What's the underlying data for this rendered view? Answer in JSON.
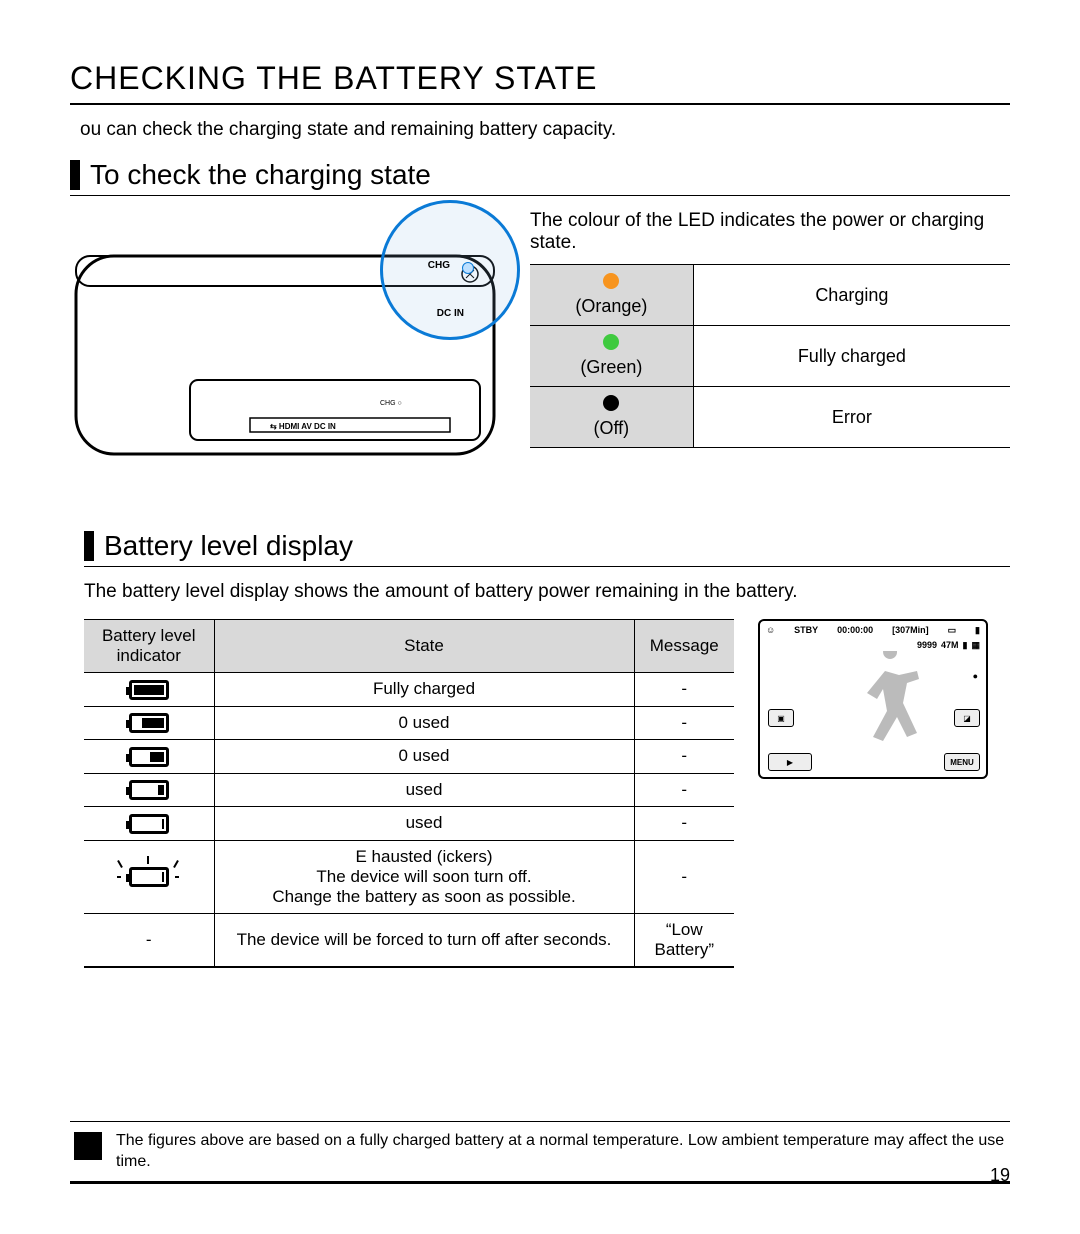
{
  "title": "CHECKING THE BATTERY STATE",
  "intro": "ou can check the charging state and remaining battery capacity.",
  "section1": {
    "heading": "To check the charging state",
    "legend_intro": "The colour of the LED indicates the power or charging state.",
    "cam_labels": {
      "chg": "CHG",
      "dcin": "DC IN"
    },
    "rows": [
      {
        "color_name": "(Orange)",
        "meaning": "Charging"
      },
      {
        "color_name": "(Green)",
        "meaning": "Fully charged"
      },
      {
        "color_name": "(Off)",
        "meaning": "Error"
      }
    ]
  },
  "section2": {
    "heading": "Battery level display",
    "intro": "The battery level display shows the amount of battery power remaining in the battery.",
    "headers": {
      "c1": "Battery level indicator",
      "c2": "State",
      "c3": "Message"
    },
    "rows": [
      {
        "state": "Fully charged",
        "msg": "-"
      },
      {
        "state": "0   used",
        "msg": "-"
      },
      {
        "state": "0     used",
        "msg": "-"
      },
      {
        "state": "used",
        "msg": "-"
      },
      {
        "state": "used",
        "msg": "-"
      },
      {
        "state": "E hausted (ickers)\nThe device will soon turn off.\nChange the battery as soon as possible.",
        "msg": "-"
      },
      {
        "state": "The device will be forced to turn off after   seconds.",
        "msg": "“Low Battery”"
      }
    ],
    "preview": {
      "stby": "STBY",
      "time": "00:00:00",
      "rem": "[307Min]",
      "shots": "9999",
      "mp": "47M",
      "menu": "MENU"
    }
  },
  "footnote": "The figures above are based on a fully charged battery at a normal temperature. Low ambient temperature may affect the use time.",
  "page_number": "19"
}
